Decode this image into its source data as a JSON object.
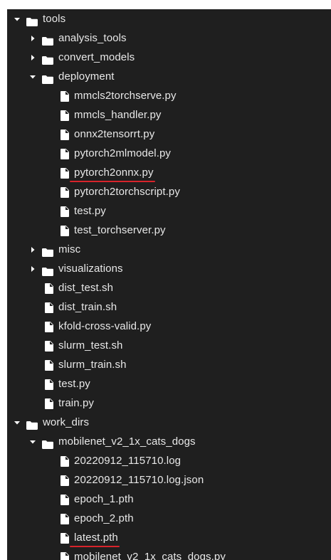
{
  "file_tree": {
    "items": [
      {
        "label": "tools",
        "type": "folder",
        "depth": 0,
        "expanded": true
      },
      {
        "label": "analysis_tools",
        "type": "folder",
        "depth": 1,
        "expanded": false
      },
      {
        "label": "convert_models",
        "type": "folder",
        "depth": 1,
        "expanded": false
      },
      {
        "label": "deployment",
        "type": "folder",
        "depth": 1,
        "expanded": true
      },
      {
        "label": "mmcls2torchserve.py",
        "type": "file",
        "depth": 2
      },
      {
        "label": "mmcls_handler.py",
        "type": "file",
        "depth": 2
      },
      {
        "label": "onnx2tensorrt.py",
        "type": "file",
        "depth": 2
      },
      {
        "label": "pytorch2mlmodel.py",
        "type": "file",
        "depth": 2
      },
      {
        "label": "pytorch2onnx.py",
        "type": "file",
        "depth": 2,
        "underlined": true
      },
      {
        "label": "pytorch2torchscript.py",
        "type": "file",
        "depth": 2
      },
      {
        "label": "test.py",
        "type": "file",
        "depth": 2
      },
      {
        "label": "test_torchserver.py",
        "type": "file",
        "depth": 2
      },
      {
        "label": "misc",
        "type": "folder",
        "depth": 1,
        "expanded": false
      },
      {
        "label": "visualizations",
        "type": "folder",
        "depth": 1,
        "expanded": false
      },
      {
        "label": "dist_test.sh",
        "type": "file",
        "depth": 1
      },
      {
        "label": "dist_train.sh",
        "type": "file",
        "depth": 1
      },
      {
        "label": "kfold-cross-valid.py",
        "type": "file",
        "depth": 1
      },
      {
        "label": "slurm_test.sh",
        "type": "file",
        "depth": 1
      },
      {
        "label": "slurm_train.sh",
        "type": "file",
        "depth": 1
      },
      {
        "label": "test.py",
        "type": "file",
        "depth": 1
      },
      {
        "label": "train.py",
        "type": "file",
        "depth": 1
      },
      {
        "label": "work_dirs",
        "type": "folder",
        "depth": 0,
        "expanded": true
      },
      {
        "label": "mobilenet_v2_1x_cats_dogs",
        "type": "folder",
        "depth": 1,
        "expanded": true
      },
      {
        "label": "20220912_115710.log",
        "type": "file",
        "depth": 2
      },
      {
        "label": "20220912_115710.log.json",
        "type": "file",
        "depth": 2
      },
      {
        "label": "epoch_1.pth",
        "type": "file",
        "depth": 2
      },
      {
        "label": "epoch_2.pth",
        "type": "file",
        "depth": 2
      },
      {
        "label": "latest.pth",
        "type": "file",
        "depth": 2,
        "underlined": true
      },
      {
        "label": "mobilenet_v2_1x_cats_dogs.py",
        "type": "file",
        "depth": 2
      }
    ]
  },
  "icons": {
    "folder": "folder-icon",
    "file": "file-icon",
    "expanded": "chevron-down-icon",
    "collapsed": "chevron-right-icon"
  },
  "colors": {
    "background": "#1f1f1f",
    "text": "#e8e8e8",
    "icon": "#ffffff",
    "annotation_underline": "#d8242b"
  }
}
